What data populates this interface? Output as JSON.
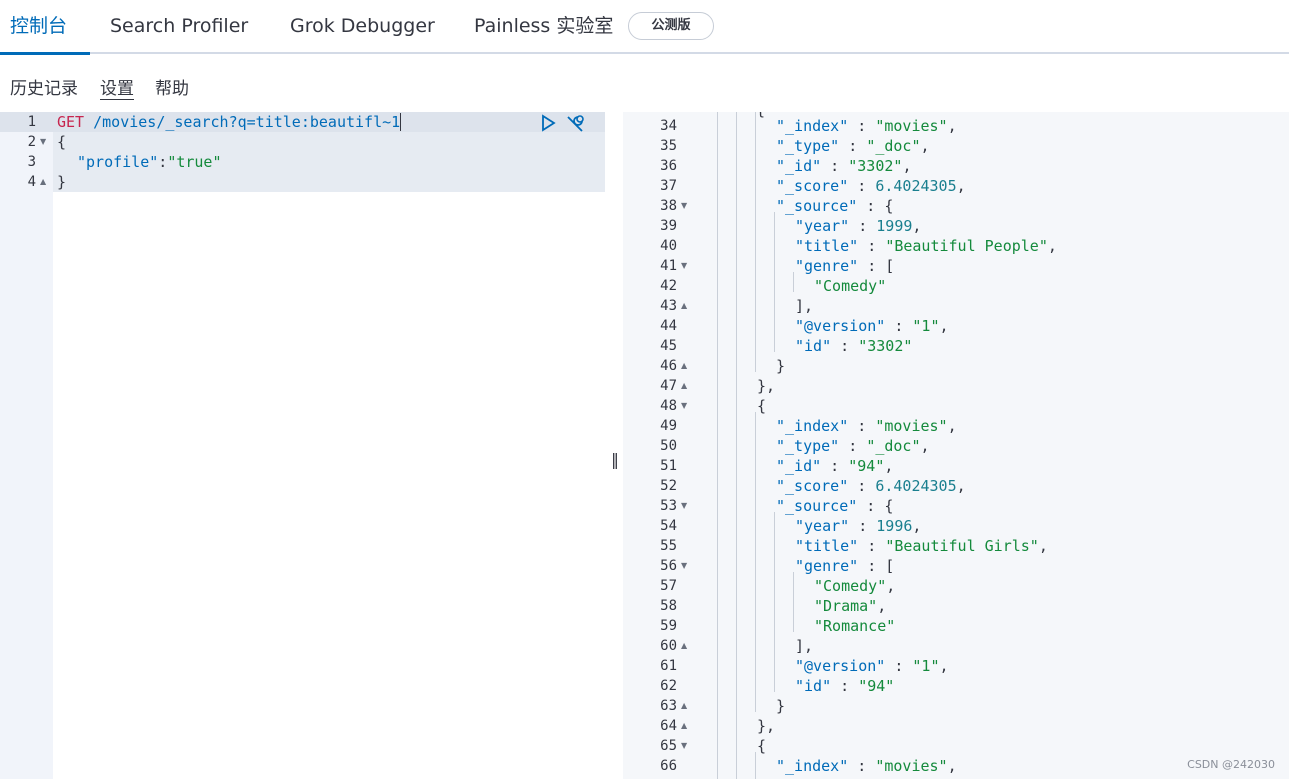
{
  "tabs": [
    {
      "label": "控制台",
      "active": true
    },
    {
      "label": "Search Profiler",
      "active": false
    },
    {
      "label": "Grok Debugger",
      "active": false
    },
    {
      "label": "Painless 实验室",
      "active": false
    }
  ],
  "beta_badge": "公测版",
  "menu": {
    "history": "历史记录",
    "settings": "设置",
    "help": "帮助"
  },
  "editor": {
    "lines": [
      {
        "n": "1",
        "method": "GET",
        "path": "/movies/_search?q=title:beautifl~1"
      },
      {
        "n": "2",
        "text": "{"
      },
      {
        "n": "3",
        "key": "\"profile\"",
        "sep": ":",
        "value": "\"true\""
      },
      {
        "n": "4",
        "text": "}"
      }
    ],
    "run_icon": "play-icon",
    "wrench_icon": "wrench-icon"
  },
  "output": {
    "lines": [
      {
        "n": "34",
        "text": "\"_index\" : \"movies\","
      },
      {
        "n": "35",
        "text": "\"_type\" : \"_doc\","
      },
      {
        "n": "36",
        "text": "\"_id\" : \"3302\","
      },
      {
        "n": "37",
        "text": "\"_score\" : 6.4024305,"
      },
      {
        "n": "38",
        "text": "\"_source\" : {"
      },
      {
        "n": "39",
        "text": "\"year\" : 1999,"
      },
      {
        "n": "40",
        "text": "\"title\" : \"Beautiful People\","
      },
      {
        "n": "41",
        "text": "\"genre\" : ["
      },
      {
        "n": "42",
        "text": "\"Comedy\""
      },
      {
        "n": "43",
        "text": "],"
      },
      {
        "n": "44",
        "text": "\"@version\" : \"1\","
      },
      {
        "n": "45",
        "text": "\"id\" : \"3302\""
      },
      {
        "n": "46",
        "text": "}"
      },
      {
        "n": "47",
        "text": "},"
      },
      {
        "n": "48",
        "text": "{"
      },
      {
        "n": "49",
        "text": "\"_index\" : \"movies\","
      },
      {
        "n": "50",
        "text": "\"_type\" : \"_doc\","
      },
      {
        "n": "51",
        "text": "\"_id\" : \"94\","
      },
      {
        "n": "52",
        "text": "\"_score\" : 6.4024305,"
      },
      {
        "n": "53",
        "text": "\"_source\" : {"
      },
      {
        "n": "54",
        "text": "\"year\" : 1996,"
      },
      {
        "n": "55",
        "text": "\"title\" : \"Beautiful Girls\","
      },
      {
        "n": "56",
        "text": "\"genre\" : ["
      },
      {
        "n": "57",
        "text": "\"Comedy\","
      },
      {
        "n": "58",
        "text": "\"Drama\","
      },
      {
        "n": "59",
        "text": "\"Romance\""
      },
      {
        "n": "60",
        "text": "],"
      },
      {
        "n": "61",
        "text": "\"@version\" : \"1\","
      },
      {
        "n": "62",
        "text": "\"id\" : \"94\""
      },
      {
        "n": "63",
        "text": "}"
      },
      {
        "n": "64",
        "text": "},"
      },
      {
        "n": "65",
        "text": "{"
      },
      {
        "n": "66",
        "text": "\"_index\" : \"movies\","
      }
    ]
  },
  "watermark": "CSDN @242030",
  "colors": {
    "accent": "#006bb8",
    "keyword": "#c7254e",
    "string": "#148a3c",
    "number": "#1a7f8f"
  }
}
